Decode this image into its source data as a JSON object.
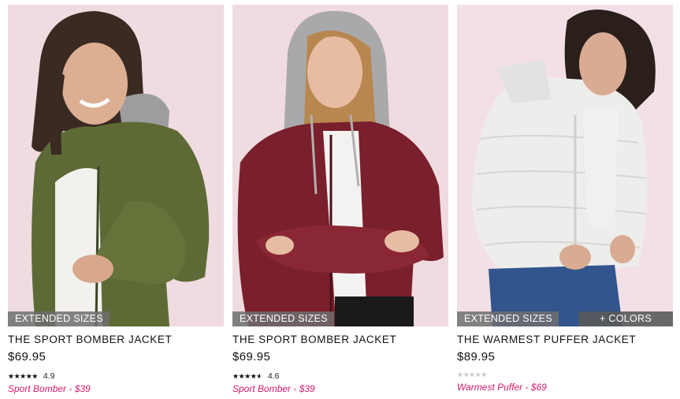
{
  "products": [
    {
      "name": "THE SPORT BOMBER JACKET",
      "price": "$69.95",
      "badge": "EXTENDED SIZES",
      "rating_value": 4.9,
      "rating_label": "4.9",
      "promo": "Sport Bomber - $39",
      "jacket_color": "#5d6a36",
      "image_subject": "woman in olive bomber jacket with grey hood"
    },
    {
      "name": "THE SPORT BOMBER JACKET",
      "price": "$69.95",
      "badge": "EXTENDED SIZES",
      "rating_value": 4.6,
      "rating_label": "4.6",
      "promo": "Sport Bomber - $39",
      "jacket_color": "#7a1f2c",
      "image_subject": "woman in burgundy bomber jacket with grey hood up"
    },
    {
      "name": "THE WARMEST PUFFER JACKET",
      "price": "$89.95",
      "badge": "EXTENDED SIZES",
      "colors_label": "+ COLORS",
      "rating_value": 0,
      "rating_label": "",
      "promo": "Warmest Puffer - $69",
      "jacket_color": "#ededec",
      "image_subject": "woman in white puffer jacket and jeans"
    }
  ],
  "theme": {
    "background": "#ffffff",
    "photo_backdrop": "#efd9df",
    "promo_color": "#d4186f",
    "badge_bg": "#6e6e6e"
  },
  "icons": {
    "star": "★"
  }
}
